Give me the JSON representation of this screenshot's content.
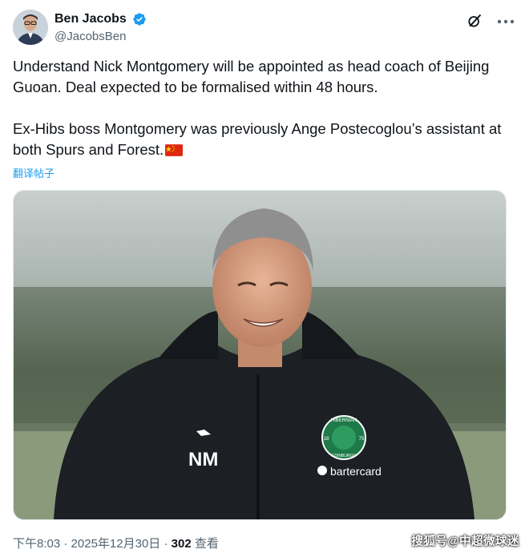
{
  "header": {
    "display_name": "Ben Jacobs",
    "handle": "@JacobsBen"
  },
  "icons": {
    "verified": "verified-badge-icon",
    "grok": "grok-icon",
    "more": "more-icon",
    "flag": "china-flag-icon"
  },
  "tweet": {
    "paragraph_1": "Understand Nick Montgomery will be appointed as head coach of Beijing Guoan. Deal expected to be formalised within 48 hours.",
    "paragraph_2": "Ex-Hibs boss Montgomery was previously Ange Postecoglou’s assistant at both Spurs and Forest.",
    "translate_label": "翻译帖子"
  },
  "media": {
    "jacket_initials": "NM",
    "sponsor_text": "bartercard",
    "crest_text": "HIBERNIAN",
    "crest_year_left": "18",
    "crest_year_right": "75",
    "crest_city": "EDINBURGH"
  },
  "footer": {
    "time": "下午8:03",
    "date": "2025年12月30日",
    "views_count": "302",
    "views_label": "查看"
  },
  "watermark": "搜狐号@中超微球迷",
  "colors": {
    "link": "#1d9bf0",
    "verified": "#1d9bf0",
    "muted": "#536471"
  }
}
